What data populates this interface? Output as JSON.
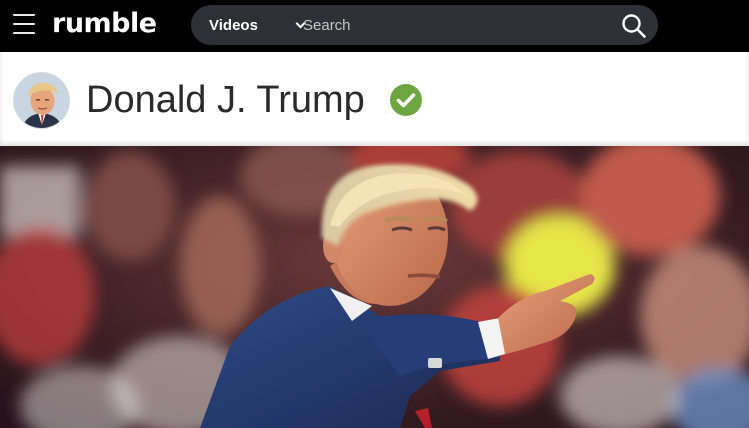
{
  "header": {
    "logo_text": "rumble",
    "menu_icon": "hamburger-menu-icon",
    "category_selected": "Videos",
    "search_placeholder": "Search",
    "search_icon": "search-icon"
  },
  "channel": {
    "name": "Donald J. Trump",
    "verified": true,
    "verified_color": "#6da540"
  },
  "colors": {
    "topbar": "#000000",
    "searchbar": "#2f3035"
  }
}
